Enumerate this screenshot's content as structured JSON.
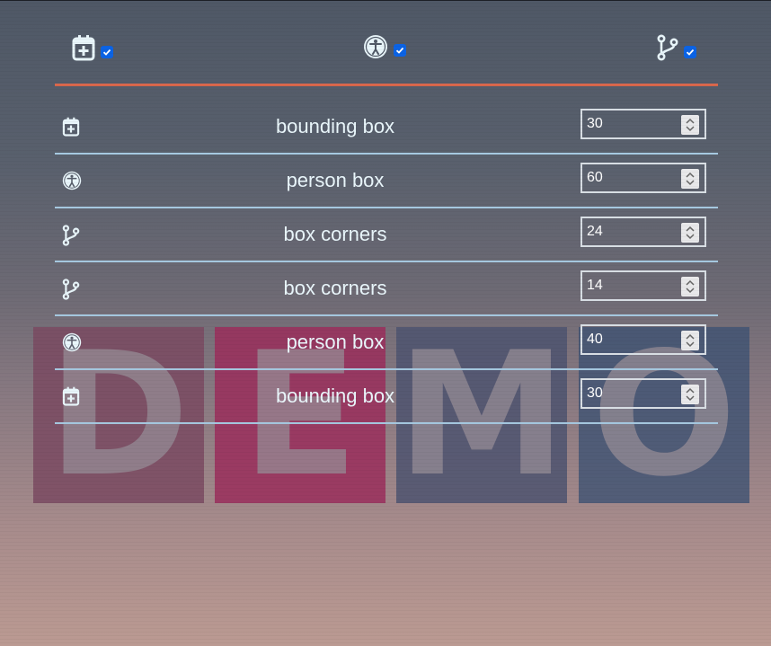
{
  "header": {
    "toggles": [
      {
        "icon": "calendar-plus-icon",
        "checked": true
      },
      {
        "icon": "accessibility-icon",
        "checked": true
      },
      {
        "icon": "git-branch-icon",
        "checked": true
      }
    ]
  },
  "rows": [
    {
      "icon": "calendar-plus-icon",
      "label": "bounding box",
      "value": "30"
    },
    {
      "icon": "accessibility-icon",
      "label": "person box",
      "value": "60"
    },
    {
      "icon": "git-branch-icon",
      "label": "box corners",
      "value": "24"
    },
    {
      "icon": "git-branch-icon",
      "label": "box corners",
      "value": "14"
    },
    {
      "icon": "accessibility-icon",
      "label": "person box",
      "value": "40"
    },
    {
      "icon": "calendar-plus-icon",
      "label": "bounding box",
      "value": "30"
    }
  ],
  "watermark": {
    "letters": [
      "D",
      "E",
      "M",
      "O"
    ]
  },
  "colors": {
    "accent_rule": "#d9674c",
    "row_divider": "#a8cbe3",
    "checkbox": "#0b63e5"
  }
}
